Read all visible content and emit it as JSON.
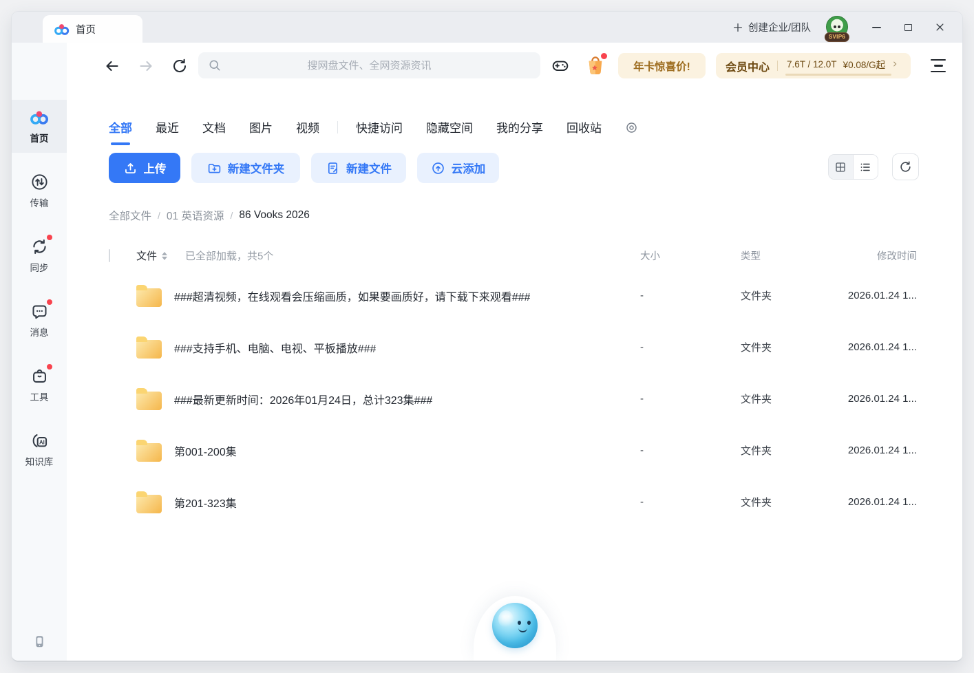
{
  "titlebar": {
    "tab_label": "首页",
    "create_team_label": "创建企业/团队",
    "avatar_badge": "SVIP6"
  },
  "toolbar": {
    "search_placeholder": "搜网盘文件、全网资源资讯",
    "promo_button": "年卡惊喜价!",
    "vip_center": "会员中心",
    "storage_usage": "7.6T / 12.0T",
    "storage_price": "¥0.08/G起",
    "storage_fill_percent": 60
  },
  "tabs": {
    "items": [
      "全部",
      "最近",
      "文档",
      "图片",
      "视频",
      "快捷访问",
      "隐藏空间",
      "我的分享",
      "回收站"
    ],
    "active": "全部"
  },
  "actions": {
    "upload": "上传",
    "new_folder": "新建文件夹",
    "new_file": "新建文件",
    "cloud_add": "云添加"
  },
  "breadcrumb": {
    "items": [
      "全部文件",
      "01 英语资源",
      "86 Vooks 2026"
    ],
    "separator": "/"
  },
  "file_table": {
    "columns": {
      "file": "文件",
      "size": "大小",
      "type": "类型",
      "modified": "修改时间"
    },
    "load_status": "已全部加载，共5个",
    "rows": [
      {
        "name": "###超清视频，在线观看会压缩画质，如果要画质好，请下载下来观看###",
        "size": "-",
        "type": "文件夹",
        "modified": "2026.01.24 1..."
      },
      {
        "name": "###支持手机、电脑、电视、平板播放###",
        "size": "-",
        "type": "文件夹",
        "modified": "2026.01.24 1..."
      },
      {
        "name": "###最新更新时间：2026年01月24日，总计323集###",
        "size": "-",
        "type": "文件夹",
        "modified": "2026.01.24 1..."
      },
      {
        "name": "第001-200集",
        "size": "-",
        "type": "文件夹",
        "modified": "2026.01.24 1..."
      },
      {
        "name": "第201-323集",
        "size": "-",
        "type": "文件夹",
        "modified": "2026.01.24 1..."
      }
    ]
  },
  "sidebar": {
    "items": [
      {
        "label": "首页",
        "active": true
      },
      {
        "label": "传输",
        "badge": false
      },
      {
        "label": "同步",
        "badge": true
      },
      {
        "label": "消息",
        "badge": true
      },
      {
        "label": "工具",
        "badge": true
      },
      {
        "label": "知识库",
        "badge": false
      }
    ]
  },
  "colors": {
    "accent": "#3478f6",
    "accent-bg": "#e9f1fe",
    "promo-bg": "#fbf2e0",
    "promo-text": "#9c6b1d",
    "badge-red": "#f8434e",
    "folder-a": "#fdeaae",
    "folder-b": "#f5b64b",
    "folder-tab": "#fbd572"
  }
}
